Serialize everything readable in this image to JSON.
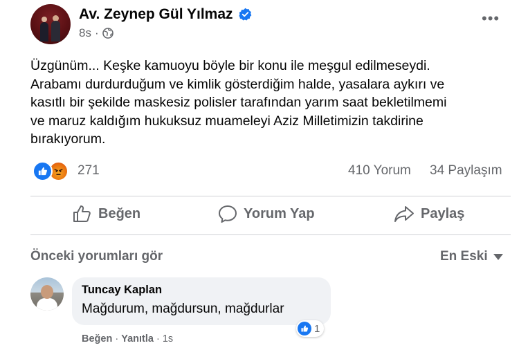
{
  "post": {
    "author": "Av. Zeynep Gül Yılmaz",
    "time": "8s",
    "text": "Üzgünüm... Keşke kamuoyu böyle bir konu ile meşgul edilmeseydi.\nArabamı durdurduğum ve kimlik gösterdiğim halde, yasalara aykırı ve\nkasıtlı bir şekilde maskesiz polisler tarafından yarım saat bekletilmemi\nve maruz kaldığım hukuksuz muameleyi Aziz Milletimizin takdirine\nbırakıyorum."
  },
  "reactions": {
    "count": "271",
    "comments": "410 Yorum",
    "shares": "34 Paylaşım"
  },
  "actions": {
    "like": "Beğen",
    "comment": "Yorum Yap",
    "share": "Paylaş"
  },
  "comments_section": {
    "prev_label": "Önceki yorumları gör",
    "sort_label": "En Eski"
  },
  "comment": {
    "author": "Tuncay Kaplan",
    "text": "Mağdurum, mağdursun, mağdurlar",
    "reaction_count": "1",
    "like": "Beğen",
    "reply": "Yanıtla",
    "time": "1s"
  },
  "colors": {
    "accent": "#1877f2",
    "secondary_text": "#65676b",
    "bubble": "#f0f2f5"
  },
  "icons": [
    "verified-icon",
    "globe-icon",
    "more-icon",
    "like-reaction-icon",
    "angry-reaction-icon",
    "thumbs-up-icon",
    "comment-icon",
    "share-icon",
    "caret-down-icon"
  ]
}
